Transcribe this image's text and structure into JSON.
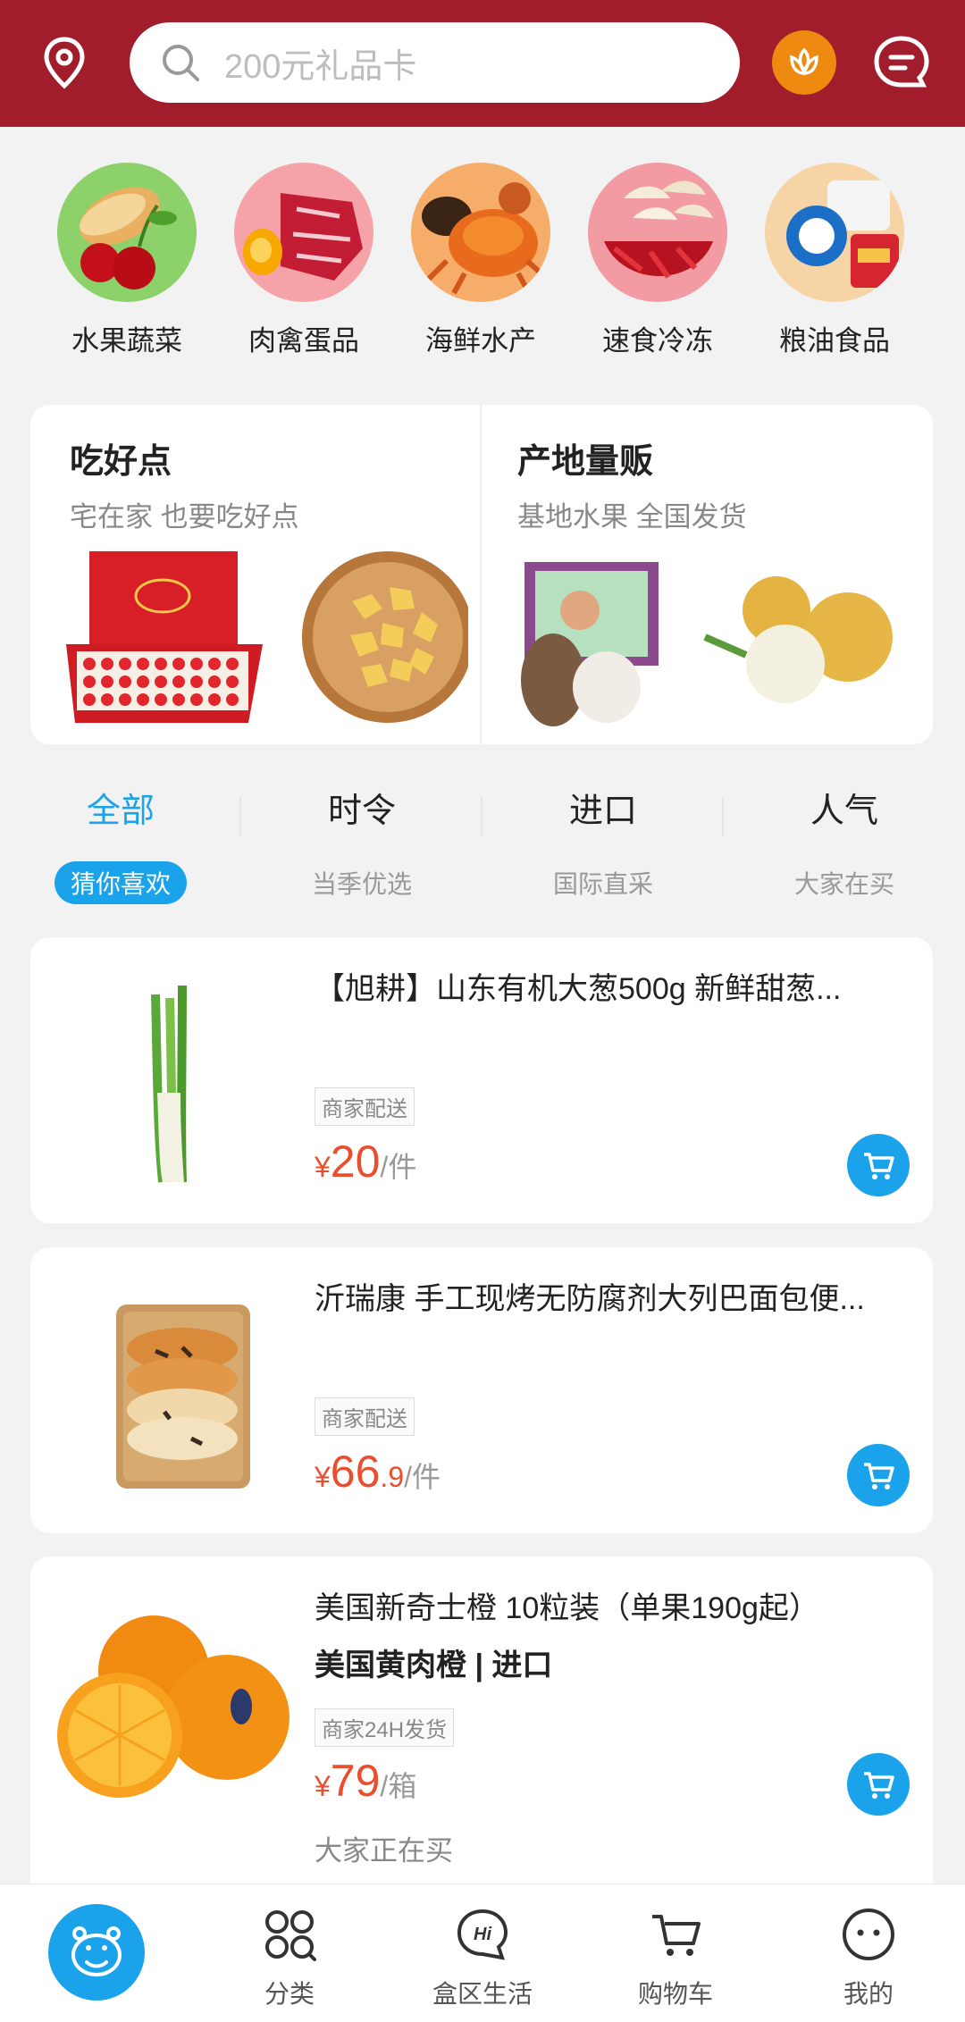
{
  "header": {
    "search_placeholder": "200元礼品卡",
    "colors": {
      "brand": "#a21d2c",
      "accent": "#1aa3ea",
      "price": "#e94e2e"
    }
  },
  "categories": [
    {
      "label": "水果蔬菜",
      "icon": "fruit-veg-image"
    },
    {
      "label": "肉禽蛋品",
      "icon": "meat-egg-image"
    },
    {
      "label": "海鲜水产",
      "icon": "seafood-image"
    },
    {
      "label": "速食冷冻",
      "icon": "frozen-food-image"
    },
    {
      "label": "粮油食品",
      "icon": "grain-oil-image"
    }
  ],
  "promo": {
    "left": {
      "title": "吃好点",
      "subtitle": "宅在家 也要吃好点"
    },
    "right": {
      "title": "产地量贩",
      "subtitle": "基地水果 全国发货"
    }
  },
  "tabs": [
    {
      "title": "全部",
      "sub": "猜你喜欢"
    },
    {
      "title": "时令",
      "sub": "当季优选"
    },
    {
      "title": "进口",
      "sub": "国际直采"
    },
    {
      "title": "人气",
      "sub": "大家在买"
    }
  ],
  "products": [
    {
      "title": "【旭耕】山东有机大葱500g 新鲜甜葱...",
      "tag": "商家配送",
      "price_int": "20",
      "price_dec": "",
      "unit": "/件"
    },
    {
      "title": "沂瑞康 手工现烤无防腐剂大列巴面包便...",
      "tag": "商家配送",
      "price_int": "66",
      "price_dec": ".9",
      "unit": "/件"
    },
    {
      "title": "美国新奇士橙 10粒装（单果190g起）",
      "subtitle": "美国黄肉橙 | 进口",
      "tag": "商家24H发货",
      "price_int": "79",
      "price_dec": "",
      "unit": "/箱",
      "extra": "大家正在买"
    }
  ],
  "currency": "¥",
  "nav": [
    {
      "label": "",
      "icon": "hippo-home-icon"
    },
    {
      "label": "分类",
      "icon": "category-icon"
    },
    {
      "label": "盒区生活",
      "icon": "hi-chat-icon"
    },
    {
      "label": "购物车",
      "icon": "cart-icon"
    },
    {
      "label": "我的",
      "icon": "profile-face-icon"
    }
  ]
}
